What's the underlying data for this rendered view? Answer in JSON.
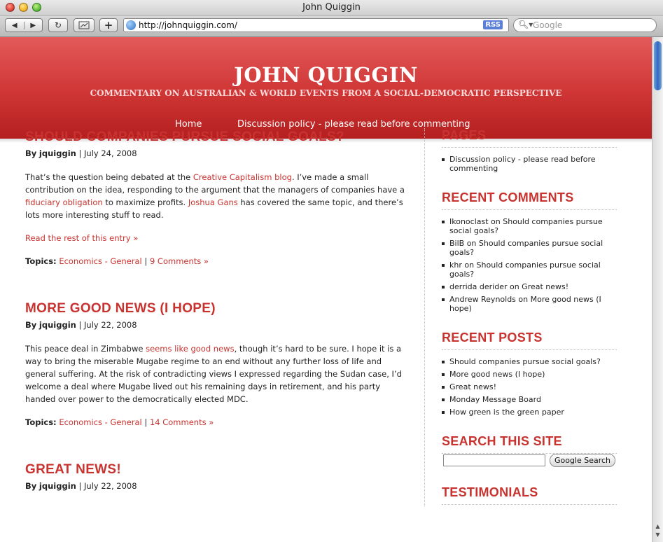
{
  "window": {
    "title": "John Quiggin"
  },
  "toolbar": {
    "back_icon": "back-arrow-icon",
    "forward_icon": "forward-arrow-icon",
    "url": "http://johnquiggin.com/",
    "rss_label": "RSS",
    "search_placeholder": "Google"
  },
  "site": {
    "title": "JOHN QUIGGIN",
    "tagline": "COMMENTARY ON AUSTRALIAN & WORLD EVENTS FROM A SOCIAL-DEMOCRATIC PERSPECTIVE",
    "nav": [
      "Home",
      "Discussion policy - please read before commenting"
    ]
  },
  "posts": [
    {
      "title": "SHOULD COMPANIES PURSUE SOCIAL GOALS?",
      "by_label": "By",
      "author": "jquiggin",
      "sep": "|",
      "date": "July 24, 2008",
      "p1": "That’s the question being debated at the ",
      "l1": "Creative Capitalism blog",
      "p2": ". I’ve made a small contribution on the idea, responding to the argument that the managers of companies have a ",
      "l2": "fiduciary obligation",
      "p3": " to maximize profits. ",
      "l3": "Joshua Gans",
      "p4": " has covered the same topic, and there’s lots more interesting stuff to read.",
      "read_more": "Read the rest of this entry »",
      "topics_label": "Topics:",
      "topic": "Economics - General",
      "comments": "9 Comments »"
    },
    {
      "title": "MORE GOOD NEWS (I HOPE)",
      "by_label": "By",
      "author": "jquiggin",
      "sep": "|",
      "date": "July 22, 2008",
      "p1": "This peace deal in Zimbabwe ",
      "l1": "seems like good news",
      "p2": ", though it’s hard to be sure. I hope it is a way to bring the miserable Mugabe regime to an end without any further loss of life and general suffering. At the risk of contradicting views I expressed regarding the Sudan case, I’d welcome a deal where Mugabe lived out his remaining days in retirement, and his party handed over power to the democratically elected MDC.",
      "topics_label": "Topics:",
      "topic": "Economics - General",
      "comments": "14 Comments »"
    },
    {
      "title": "GREAT NEWS!",
      "by_label": "By",
      "author": "jquiggin",
      "sep": "|",
      "date": "July 22, 2008"
    }
  ],
  "sidebar": {
    "pages_heading": "PAGES",
    "pages": [
      "Discussion policy - please read before commenting"
    ],
    "comments_heading": "RECENT COMMENTS",
    "comments": [
      "Ikonoclast on Should companies pursue social goals?",
      "BilB on Should companies pursue social goals?",
      "khr on Should companies pursue social goals?",
      "derrida derider on Great news!",
      "Andrew Reynolds on More good news (I hope)"
    ],
    "posts_heading": "RECENT POSTS",
    "posts": [
      "Should companies pursue social goals?",
      "More good news (I hope)",
      "Great news!",
      "Monday Message Board",
      "How green is the green paper"
    ],
    "search_heading": "SEARCH THIS SITE",
    "search_button": "Google Search",
    "search_value": "",
    "testimonials_heading": "TESTIMONIALS"
  },
  "colors": {
    "accent": "#c8332f",
    "header_top": "#e35a5a",
    "header_bottom": "#b51f1f"
  }
}
